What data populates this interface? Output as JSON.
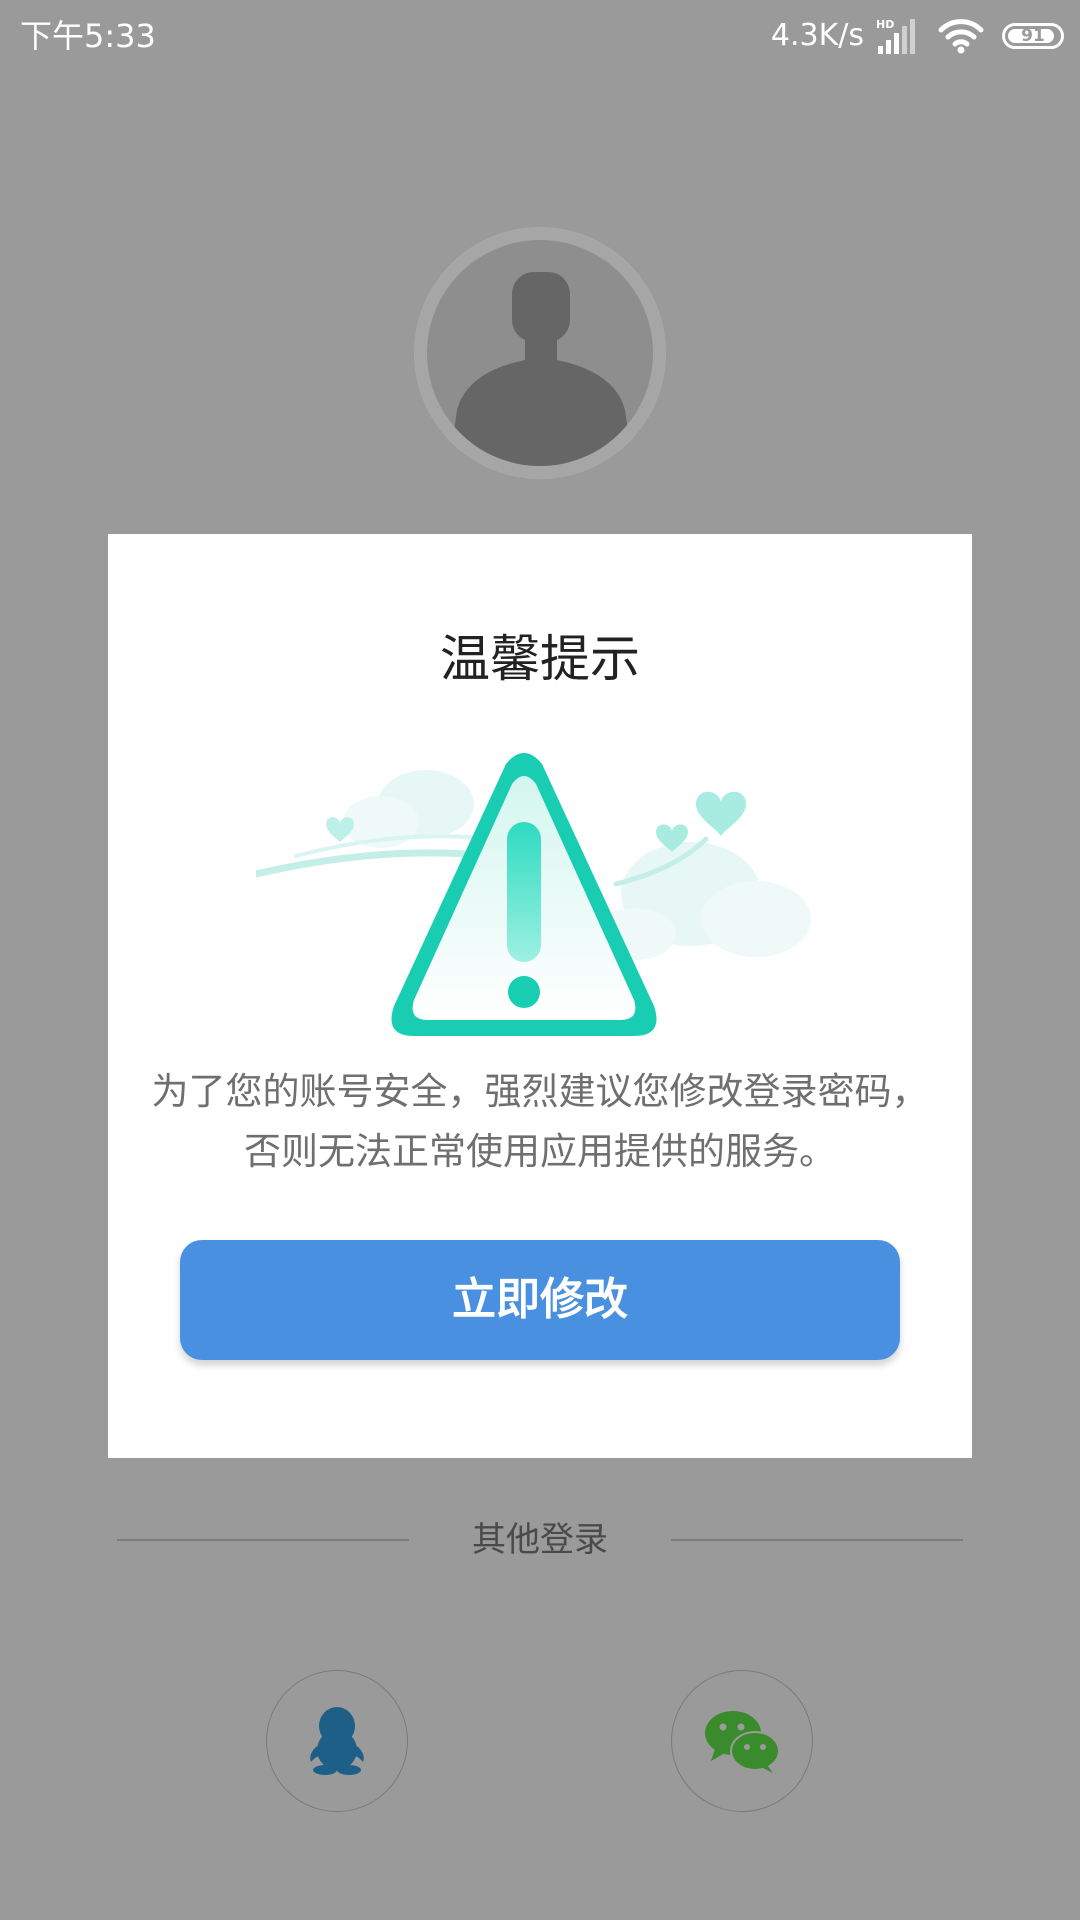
{
  "status_bar": {
    "time": "下午5:33",
    "net_speed": "4.3K/s",
    "signal_badge": "HD",
    "battery_level": "91",
    "icons": [
      "signal-icon",
      "wifi-icon",
      "battery-icon"
    ]
  },
  "background": {
    "avatar_icon": "default-avatar-icon",
    "other_login_label": "其他登录",
    "social_logins": [
      "qq-icon",
      "wechat-icon"
    ]
  },
  "dialog": {
    "title": "温馨提示",
    "illustration_icon": "warning-triangle-icon",
    "message_lines": [
      "为了您的账号安全，强烈建议您修改登录密码，",
      "否则无法正常使用应用提供的服务。"
    ],
    "primary_button_label": "立即修改"
  },
  "colors": {
    "overlay_background": "#9a9a9a",
    "button_blue": "#4a90e0",
    "warning_teal": "#1fcfb3",
    "qq_blue": "#1d5f86",
    "wechat_green": "#3a8b2c"
  }
}
